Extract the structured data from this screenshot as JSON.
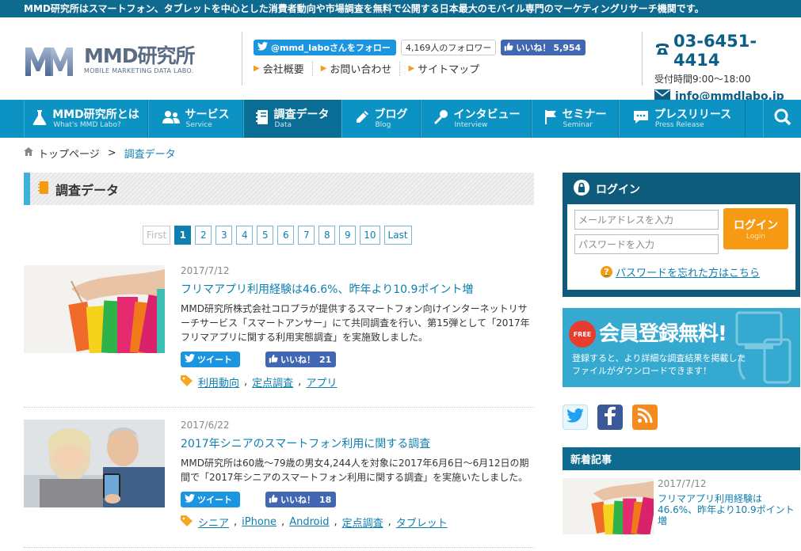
{
  "topbar": {
    "text": "MMD研究所はスマートフォン、タブレットを中心とした消費者動向や市場調査を無料で公開する日本最大のモバイル専門のマーケティングリサーチ機関です。"
  },
  "header": {
    "logo_title": "MMD研究所",
    "logo_sub": "MOBILE MARKETING DATA LABO.",
    "twitter_follow": "@mmd_laboさんをフォロー",
    "followers": "4,169人のフォロワー",
    "fb_like": "いいね！",
    "fb_count": "5,954",
    "links": [
      "会社概要",
      "お問い合わせ",
      "サイトマップ"
    ],
    "phone": "03-6451-4414",
    "hours": "受付時間9:00～18:00",
    "email": "info@mmdlabo.jp"
  },
  "nav": [
    {
      "jp": "MMD研究所とは",
      "en": "What's MMD Labo?"
    },
    {
      "jp": "サービス",
      "en": "Service"
    },
    {
      "jp": "調査データ",
      "en": "Data"
    },
    {
      "jp": "ブログ",
      "en": "Blog"
    },
    {
      "jp": "インタビュー",
      "en": "Interview"
    },
    {
      "jp": "セミナー",
      "en": "Seminar"
    },
    {
      "jp": "プレスリリース",
      "en": "Press Release"
    }
  ],
  "breadcrumb": {
    "home": "トップページ",
    "sep": ">",
    "current": "調査データ"
  },
  "section_title": "調査データ",
  "pager": [
    "First",
    "1",
    "2",
    "3",
    "4",
    "5",
    "6",
    "7",
    "8",
    "9",
    "10",
    "Last"
  ],
  "posts": [
    {
      "date": "2017/7/12",
      "title": "フリマアプリ利用経験は46.6%、昨年より10.9ポイント増",
      "excerpt": "MMD研究所株式会社コロプラが提供するスマートフォン向けインターネットリサーチサービス「スマートアンサー」にて共同調査を行い、第15弾として「2017年フリマアプリに関する利用実態調査」を実施致しました。",
      "tweet": "ツイート",
      "like": "いいね！",
      "like_count": "21",
      "tags": [
        "利用動向",
        "定点調査",
        "アプリ"
      ]
    },
    {
      "date": "2017/6/22",
      "title": "2017年シニアのスマートフォン利用に関する調査",
      "excerpt": "MMD研究所は60歳～79歳の男女4,244人を対象に2017年6月6日～6月12日の期間で「2017年シニアのスマートフォン利用に関する調査」を実施いたしました。",
      "tweet": "ツイート",
      "like": "いいね！",
      "like_count": "18",
      "tags": [
        "シニア",
        "iPhone",
        "Android",
        "定点調査",
        "タブレット"
      ]
    }
  ],
  "login": {
    "title": "ログイン",
    "email_placeholder": "メールアドレスを入力",
    "password_placeholder": "パスワードを入力",
    "button": "ログイン",
    "button_sub": "Login",
    "forgot": "パスワードを忘れた方はこちら"
  },
  "register": {
    "badge": "FREE",
    "title": "会員登録無料!",
    "text1": "登録すると、より詳細な調査結果を掲載した",
    "text2": "ファイルがダウンロードできます！"
  },
  "news": {
    "heading": "新着記事",
    "date": "2017/7/12",
    "title": "フリマアプリ利用経験は46.6%、昨年より10.9ポイント増"
  }
}
